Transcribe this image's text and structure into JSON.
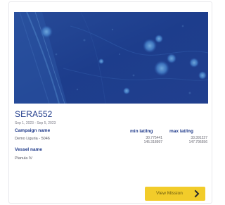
{
  "mission": {
    "name": "SERA552",
    "dates": "Sep 1, 2023 - Sep 5, 2023",
    "campaign_label": "Campaign name",
    "campaign_value": "Demo Liguria - 5046",
    "vessel_label": "Vessel name",
    "vessel_value": "Planula IV",
    "min_label": "min lat/lng",
    "max_label": "max lat/lng",
    "min_lat": "30.775441",
    "min_lng": "145.318997",
    "max_lat": "33.391227",
    "max_lng": "147.795556"
  },
  "actions": {
    "view_label": "View Mission",
    "view_icon": "chevron-right-icon"
  },
  "colors": {
    "title": "#1f3a8a",
    "button": "#f2cc2a",
    "map_deep": "#1a3a88",
    "map_light": "#4f86c6"
  }
}
